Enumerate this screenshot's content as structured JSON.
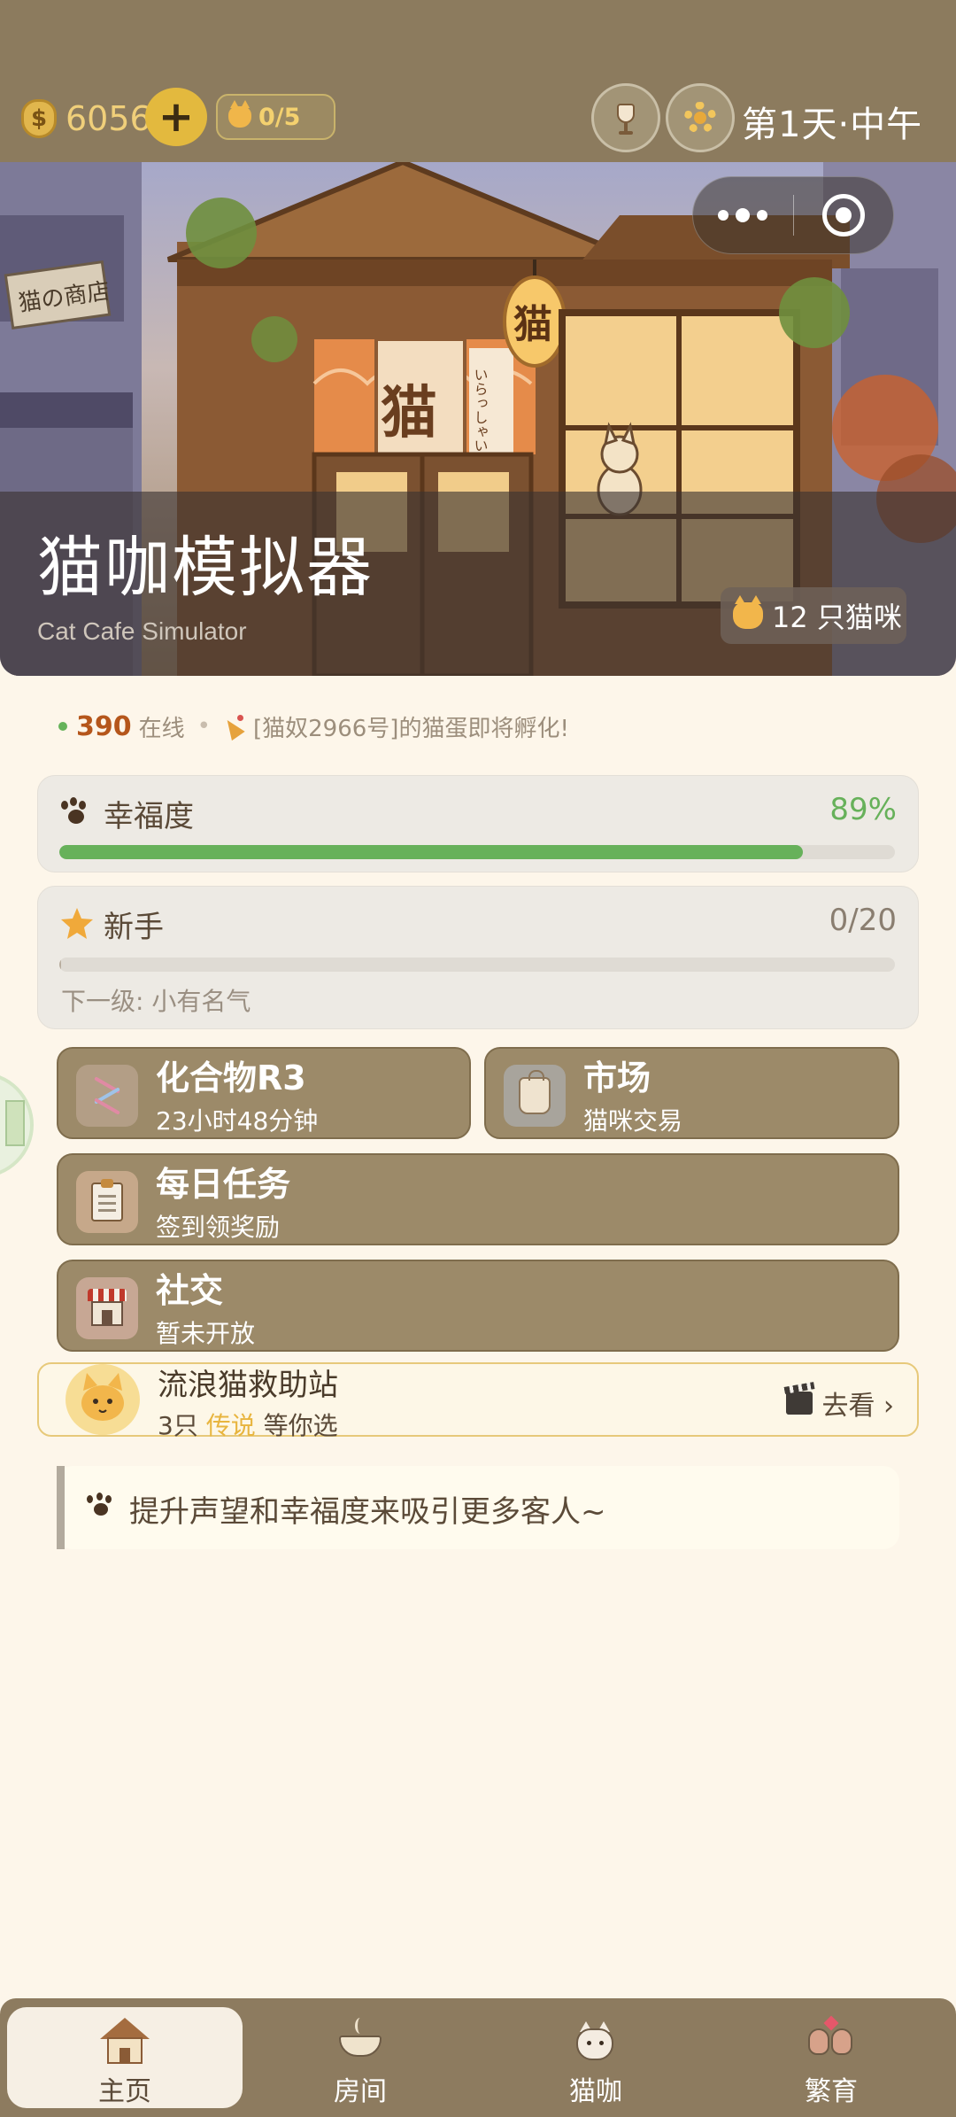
{
  "status_bar": {
    "coins": "6056",
    "coin_icon": "money-bag-icon",
    "add_icon": "plus-icon",
    "cat_slots": "0/5",
    "cat_slots_icon": "cat-icon",
    "drink_icon": "cocktail-icon",
    "settings_icon": "gear-icon",
    "day_time": "第1天·中午"
  },
  "hero": {
    "title": "猫咖模拟器",
    "subtitle": "Cat Cafe Simulator",
    "sign_text": "猫",
    "lantern_text": "猫",
    "shop_sign": "猫の商店",
    "noren_text": "いらっしゃいませ",
    "cat_count_label": "12 只猫咪",
    "more_icon": "more-dots-icon",
    "close_icon": "target-close-icon"
  },
  "ticker": {
    "online_count": "390",
    "online_label": "在线",
    "message": "[猫奴2966号]的猫蛋即将孵化!",
    "message_icon": "party-popper-icon"
  },
  "happiness": {
    "label": "幸福度",
    "value_text": "89%",
    "value": 0.89,
    "icon": "paw-icon",
    "color": "#67b15a"
  },
  "level": {
    "label": "新手",
    "progress_text": "0/20",
    "progress": 0.0,
    "next_level": "下一级: 小有名气",
    "icon": "star-icon"
  },
  "features": {
    "compound": {
      "title": "化合物R3",
      "subtitle": "23小时48分钟",
      "icon": "dna-icon"
    },
    "market": {
      "title": "市场",
      "subtitle": "猫咪交易",
      "icon": "shopping-bag-icon"
    },
    "daily": {
      "title": "每日任务",
      "subtitle": "签到领奖励",
      "icon": "clipboard-icon"
    },
    "social": {
      "title": "社交",
      "subtitle": "暂未开放",
      "icon": "cafe-shop-icon"
    }
  },
  "rescue": {
    "title": "流浪猫救助站",
    "sub_prefix": "3只",
    "sub_highlight": "传说",
    "sub_suffix": "等你选",
    "action": "去看 ›",
    "avatar_icon": "cat-face-icon",
    "action_icon": "clapperboard-icon"
  },
  "tip": {
    "text": "提升声望和幸福度来吸引更多客人~",
    "icon": "paw-icon"
  },
  "nav": {
    "items": [
      {
        "label": "主页",
        "icon": "house-icon",
        "active": true
      },
      {
        "label": "房间",
        "icon": "bowl-icon",
        "active": false
      },
      {
        "label": "猫咖",
        "icon": "cat-cup-icon",
        "active": false
      },
      {
        "label": "繁育",
        "icon": "mice-couple-icon",
        "active": false
      }
    ]
  }
}
